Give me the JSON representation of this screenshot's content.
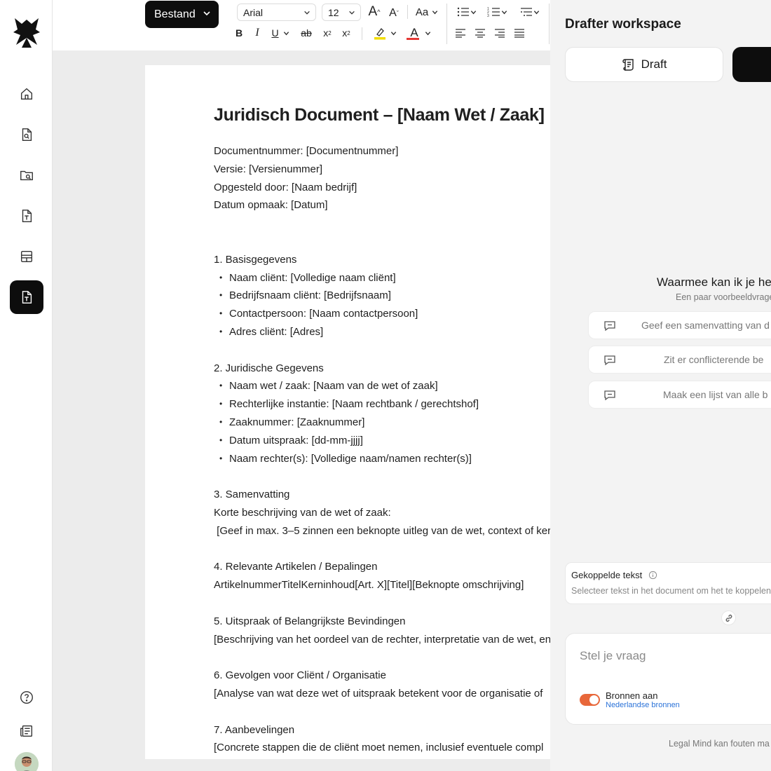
{
  "toolbar": {
    "file_menu": "Bestand",
    "font_family": "Arial",
    "font_size": "12",
    "case_label": "Aa",
    "bold": "B",
    "italic": "I",
    "underline": "U",
    "strike": "ab",
    "subscript": "x",
    "subscript_sub": "2",
    "superscript": "x",
    "superscript_sup": "2",
    "font_color": "A",
    "grow_font": "A",
    "shrink_font": "A",
    "highlight_color": "#f2dd00",
    "text_color": "#e53935"
  },
  "document": {
    "title": "Juridisch Document – [Naam Wet / Zaak]",
    "meta": [
      "Documentnummer: [Documentnummer]",
      "Versie: [Versienummer]",
      "Opgesteld door: [Naam bedrijf]",
      "Datum opmaak: [Datum]"
    ],
    "section1": {
      "heading": "1. Basisgegevens",
      "bullets": [
        "Naam cliënt: [Volledige naam cliënt]",
        "Bedrijfsnaam cliënt: [Bedrijfsnaam]",
        "Contactpersoon: [Naam contactpersoon]",
        "Adres cliënt: [Adres]"
      ]
    },
    "section2": {
      "heading": "2. Juridische Gegevens",
      "bullets": [
        "Naam wet / zaak: [Naam van de wet of zaak]",
        "Rechterlijke instantie: [Naam rechtbank / gerechtshof]",
        "Zaaknummer: [Zaaknummer]",
        "Datum uitspraak: [dd-mm-jjjj]",
        "Naam rechter(s): [Volledige naam/namen rechter(s)]"
      ]
    },
    "section3": {
      "heading": "3. Samenvatting",
      "line1": "Korte beschrijving van de wet of zaak:",
      "line2": " [Geef in max. 3–5 zinnen een beknopte uitleg van de wet, context of kern"
    },
    "section4": {
      "heading": "4. Relevante Artikelen / Bepalingen",
      "line1": "ArtikelnummerTitelKerninhoud[Art. X][Titel][Beknopte omschrijving]"
    },
    "section5": {
      "heading": "5. Uitspraak of Belangrijkste Bevindingen",
      "line1": "[Beschrijving van het oordeel van de rechter, interpretatie van de wet, en"
    },
    "section6": {
      "heading": "6. Gevolgen voor Cliënt / Organisatie",
      "line1": "[Analyse van wat deze wet of uitspraak betekent voor de organisatie of"
    },
    "section7": {
      "heading": "7. Aanbevelingen",
      "line1": "[Concrete stappen die de cliënt moet nemen, inclusief eventuele compl"
    }
  },
  "panel": {
    "title": "Drafter workspace",
    "draft_button": "Draft",
    "question_title": "Waarmee kan ik je he",
    "question_sub": "Een paar voorbeeldvrage",
    "suggestions": [
      "Geef een samenvatting van d",
      "Zit er conflicterende be",
      "Maak een lijst van alle b"
    ],
    "linked_title": "Gekoppelde tekst",
    "linked_sub": "Selecteer tekst in het document om het te koppelen",
    "ask_placeholder": "Stel je vraag",
    "sources_label": "Bronnen aan",
    "sources_link": "Nederlandse bronnen",
    "footer_note": "Legal Mind kan fouten ma",
    "toggle_color": "#e8673a"
  }
}
